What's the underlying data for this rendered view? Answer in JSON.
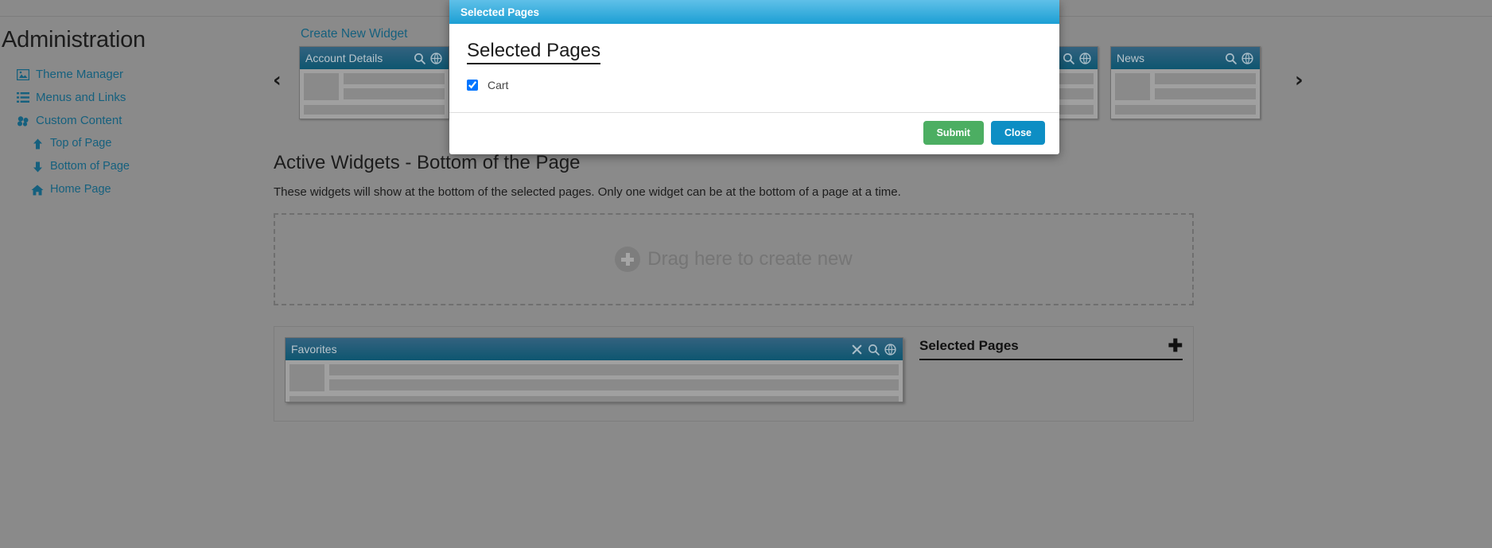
{
  "sidebar": {
    "title": "Administration",
    "items": [
      {
        "label": "Theme Manager",
        "icon": "image-icon",
        "sub": false
      },
      {
        "label": "Menus and Links",
        "icon": "list-icon",
        "sub": false
      },
      {
        "label": "Custom Content",
        "icon": "cubes-icon",
        "sub": false
      },
      {
        "label": "Top of Page",
        "icon": "arrow-up-icon",
        "sub": true
      },
      {
        "label": "Bottom of Page",
        "icon": "arrow-down-icon",
        "sub": true
      },
      {
        "label": "Home Page",
        "icon": "home-icon",
        "sub": true
      }
    ]
  },
  "main": {
    "create_link": "Create New Widget",
    "carousel": {
      "prev": "‹",
      "next": "›",
      "cards": [
        {
          "title": "Account Details",
          "icons": [
            "search-icon",
            "globe-icon"
          ]
        },
        {
          "title": "",
          "icons": [
            "search-icon",
            "globe-icon"
          ]
        },
        {
          "title": "",
          "icons": [
            "search-icon",
            "globe-icon"
          ]
        },
        {
          "title": "",
          "icons": [
            "search-icon",
            "globe-icon"
          ]
        },
        {
          "title": "",
          "icons": [
            "search-icon",
            "globe-icon"
          ]
        },
        {
          "title": "News",
          "icons": [
            "search-icon",
            "globe-icon"
          ]
        }
      ]
    },
    "section_title": "Active Widgets - Bottom of the Page",
    "section_desc": "These widgets will show at the bottom of the selected pages. Only one widget can be at the bottom of a page at a time.",
    "dropzone_text": "Drag here to create new",
    "active_widget": {
      "title": "Favorites",
      "icons": [
        "close-icon",
        "search-icon",
        "globe-icon"
      ]
    },
    "selected_pages_panel": {
      "title": "Selected Pages",
      "add_symbol": "➕"
    }
  },
  "modal": {
    "window_title": "Selected Pages",
    "heading": "Selected Pages",
    "options": [
      {
        "label": "Cart",
        "checked": true
      }
    ],
    "submit_label": "Submit",
    "close_label": "Close"
  },
  "colors": {
    "page_bg": "#8a8a8a",
    "link": "#15607e",
    "modal_header_top": "#5fc0e8",
    "modal_header_bottom": "#1c9fd4",
    "submit_green": "#4cae62",
    "close_blue": "#0d8ec4",
    "card_header_top": "#33627f",
    "card_header_bottom": "#0e5670"
  }
}
